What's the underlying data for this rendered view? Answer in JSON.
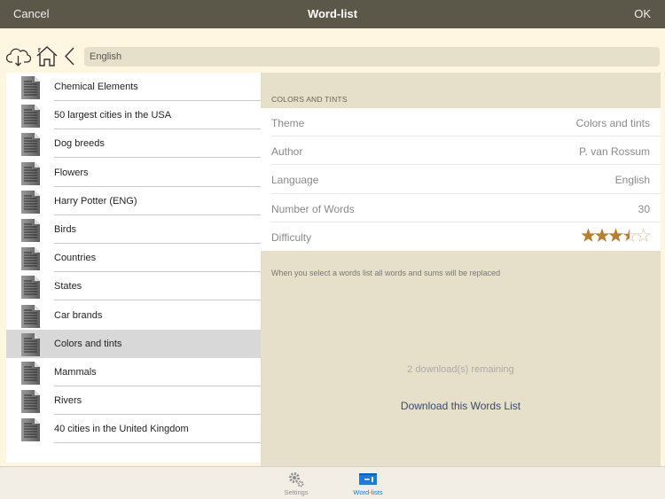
{
  "navbar": {
    "cancel_label": "Cancel",
    "title": "Word-list",
    "ok_label": "OK"
  },
  "toolbar": {
    "icons": [
      "cloud-download-icon",
      "home-icon",
      "back-chevron-icon"
    ],
    "path_value": "English"
  },
  "list": {
    "selected_index": 9,
    "items": [
      {
        "label": "Chemical Elements"
      },
      {
        "label": "50 largest cities in the USA"
      },
      {
        "label": "Dog breeds"
      },
      {
        "label": "Flowers"
      },
      {
        "label": "Harry Potter (ENG)"
      },
      {
        "label": "Birds"
      },
      {
        "label": "Countries"
      },
      {
        "label": "States"
      },
      {
        "label": "Car brands"
      },
      {
        "label": "Colors and tints"
      },
      {
        "label": "Mammals"
      },
      {
        "label": "Rivers"
      },
      {
        "label": "40 cities in the United Kingdom"
      }
    ]
  },
  "detail": {
    "section_header": "COLORS AND TINTS",
    "properties": [
      {
        "key": "Theme",
        "value": "Colors and tints"
      },
      {
        "key": "Author",
        "value": "P. van Rossum"
      },
      {
        "key": "Language",
        "value": "English"
      },
      {
        "key": "Number of Words",
        "value": "30"
      },
      {
        "key": "Difficulty",
        "value": ""
      }
    ],
    "difficulty_rating": 3.5,
    "difficulty_max": 5,
    "note": "When you select a words list all words and sums will be replaced",
    "remaining": "2 download(s) remaining",
    "download_label": "Download this Words List"
  },
  "tabbar": {
    "tabs": [
      {
        "label": "Settings",
        "icon": "gear-icon",
        "active": false
      },
      {
        "label": "Word-lists",
        "icon": "word-list-icon",
        "active": true
      }
    ]
  },
  "colors": {
    "navbar_bg": "#5b5749",
    "star": "#b97d2e",
    "tab_active": "#1a7ae0",
    "tab_inactive": "#8e8e8e",
    "link": "#3b4a6b"
  }
}
